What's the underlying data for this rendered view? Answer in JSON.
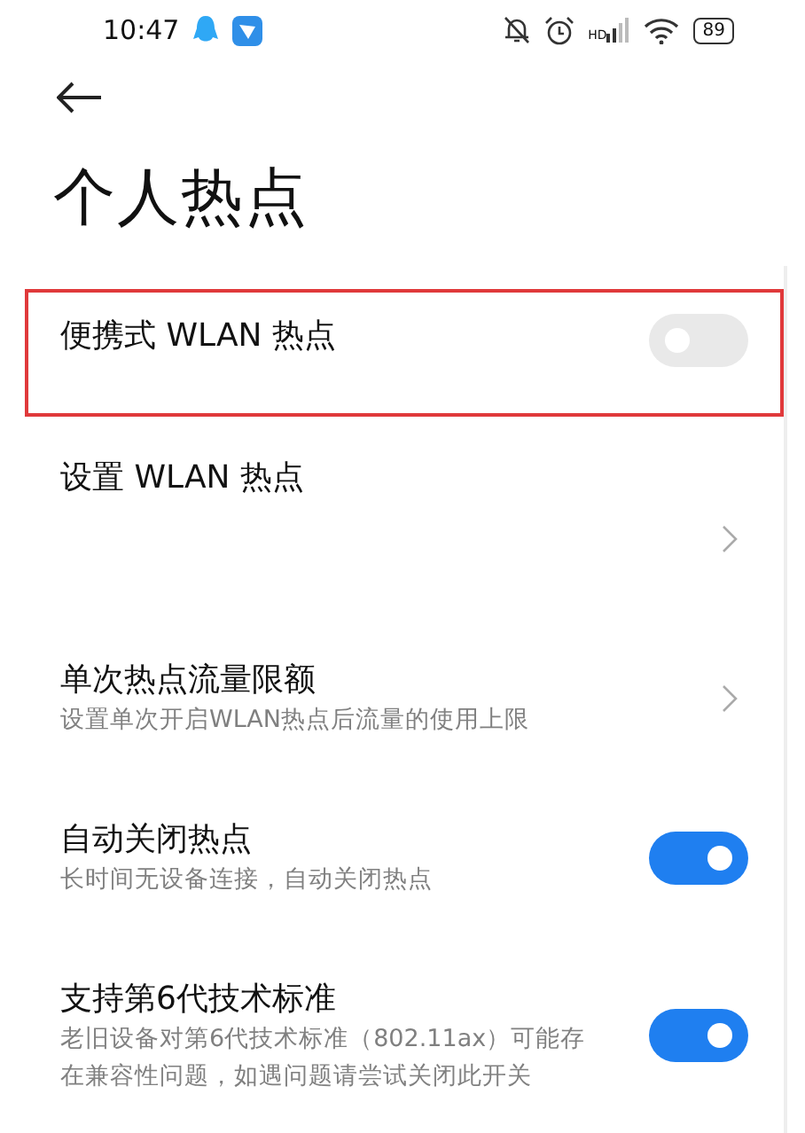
{
  "status_bar": {
    "time": "10:47",
    "network_label": "HD",
    "battery": "89"
  },
  "title": "个人热点",
  "items": [
    {
      "kind": "toggle",
      "title": "便携式 WLAN 热点",
      "on": false,
      "highlighted": true
    },
    {
      "kind": "link",
      "title": "设置 WLAN 热点",
      "highlighted": false
    },
    {
      "kind": "link",
      "title": "单次热点流量限额",
      "subtitle": "设置单次开启WLAN热点后流量的使用上限",
      "highlighted": false
    },
    {
      "kind": "toggle",
      "title": "自动关闭热点",
      "subtitle": "长时间无设备连接，自动关闭热点",
      "on": true,
      "highlighted": false
    },
    {
      "kind": "toggle",
      "title": "支持第6代技术标准",
      "subtitle": "老旧设备对第6代技术标准（802.11ax）可能存在兼容性问题，如遇问题请尝试关闭此开关",
      "on": true,
      "highlighted": false
    }
  ]
}
